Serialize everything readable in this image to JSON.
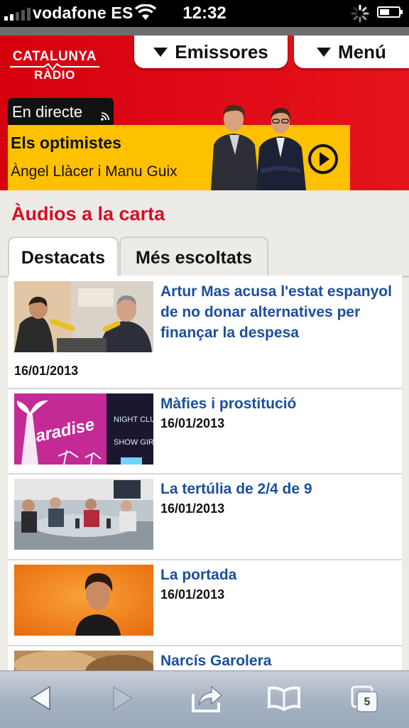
{
  "status_bar": {
    "carrier": "vodafone ES",
    "time": "12:32"
  },
  "header": {
    "logo_line1": "CATALUNYA",
    "logo_line2": "RÀDIO",
    "stations_button": "Emissores",
    "menu_button": "Menú",
    "live_label": "En directe",
    "now_playing": {
      "title": "Els optimistes",
      "hosts": "Àngel Llàcer i Manu Guix"
    }
  },
  "section": {
    "title": "Àudios a la carta",
    "tabs": [
      {
        "label": "Destacats",
        "active": true
      },
      {
        "label": "Més escoltats",
        "active": false
      }
    ]
  },
  "items": [
    {
      "title": "Artur Mas acusa l'estat espanyol de no donar alternatives per finançar la despesa",
      "date": "16/01/2013"
    },
    {
      "title": "Màfies i prostitució",
      "date": "16/01/2013"
    },
    {
      "title": "La tertúlia de 2/4 de 9",
      "date": "16/01/2013"
    },
    {
      "title": "La portada",
      "date": "16/01/2013"
    },
    {
      "title": "Narcís Garolera",
      "date": ""
    }
  ],
  "thumb_text": {
    "club_name": "aradise",
    "sign1": "NIGHT CLUB",
    "sign2": "SHOW GIRLS"
  },
  "toolbar": {
    "tab_count": "5"
  },
  "colors": {
    "brand_red": "#d6000f",
    "now_yellow": "#fdc100",
    "link_blue": "#1a4f9c",
    "section_red": "#d50f25"
  }
}
